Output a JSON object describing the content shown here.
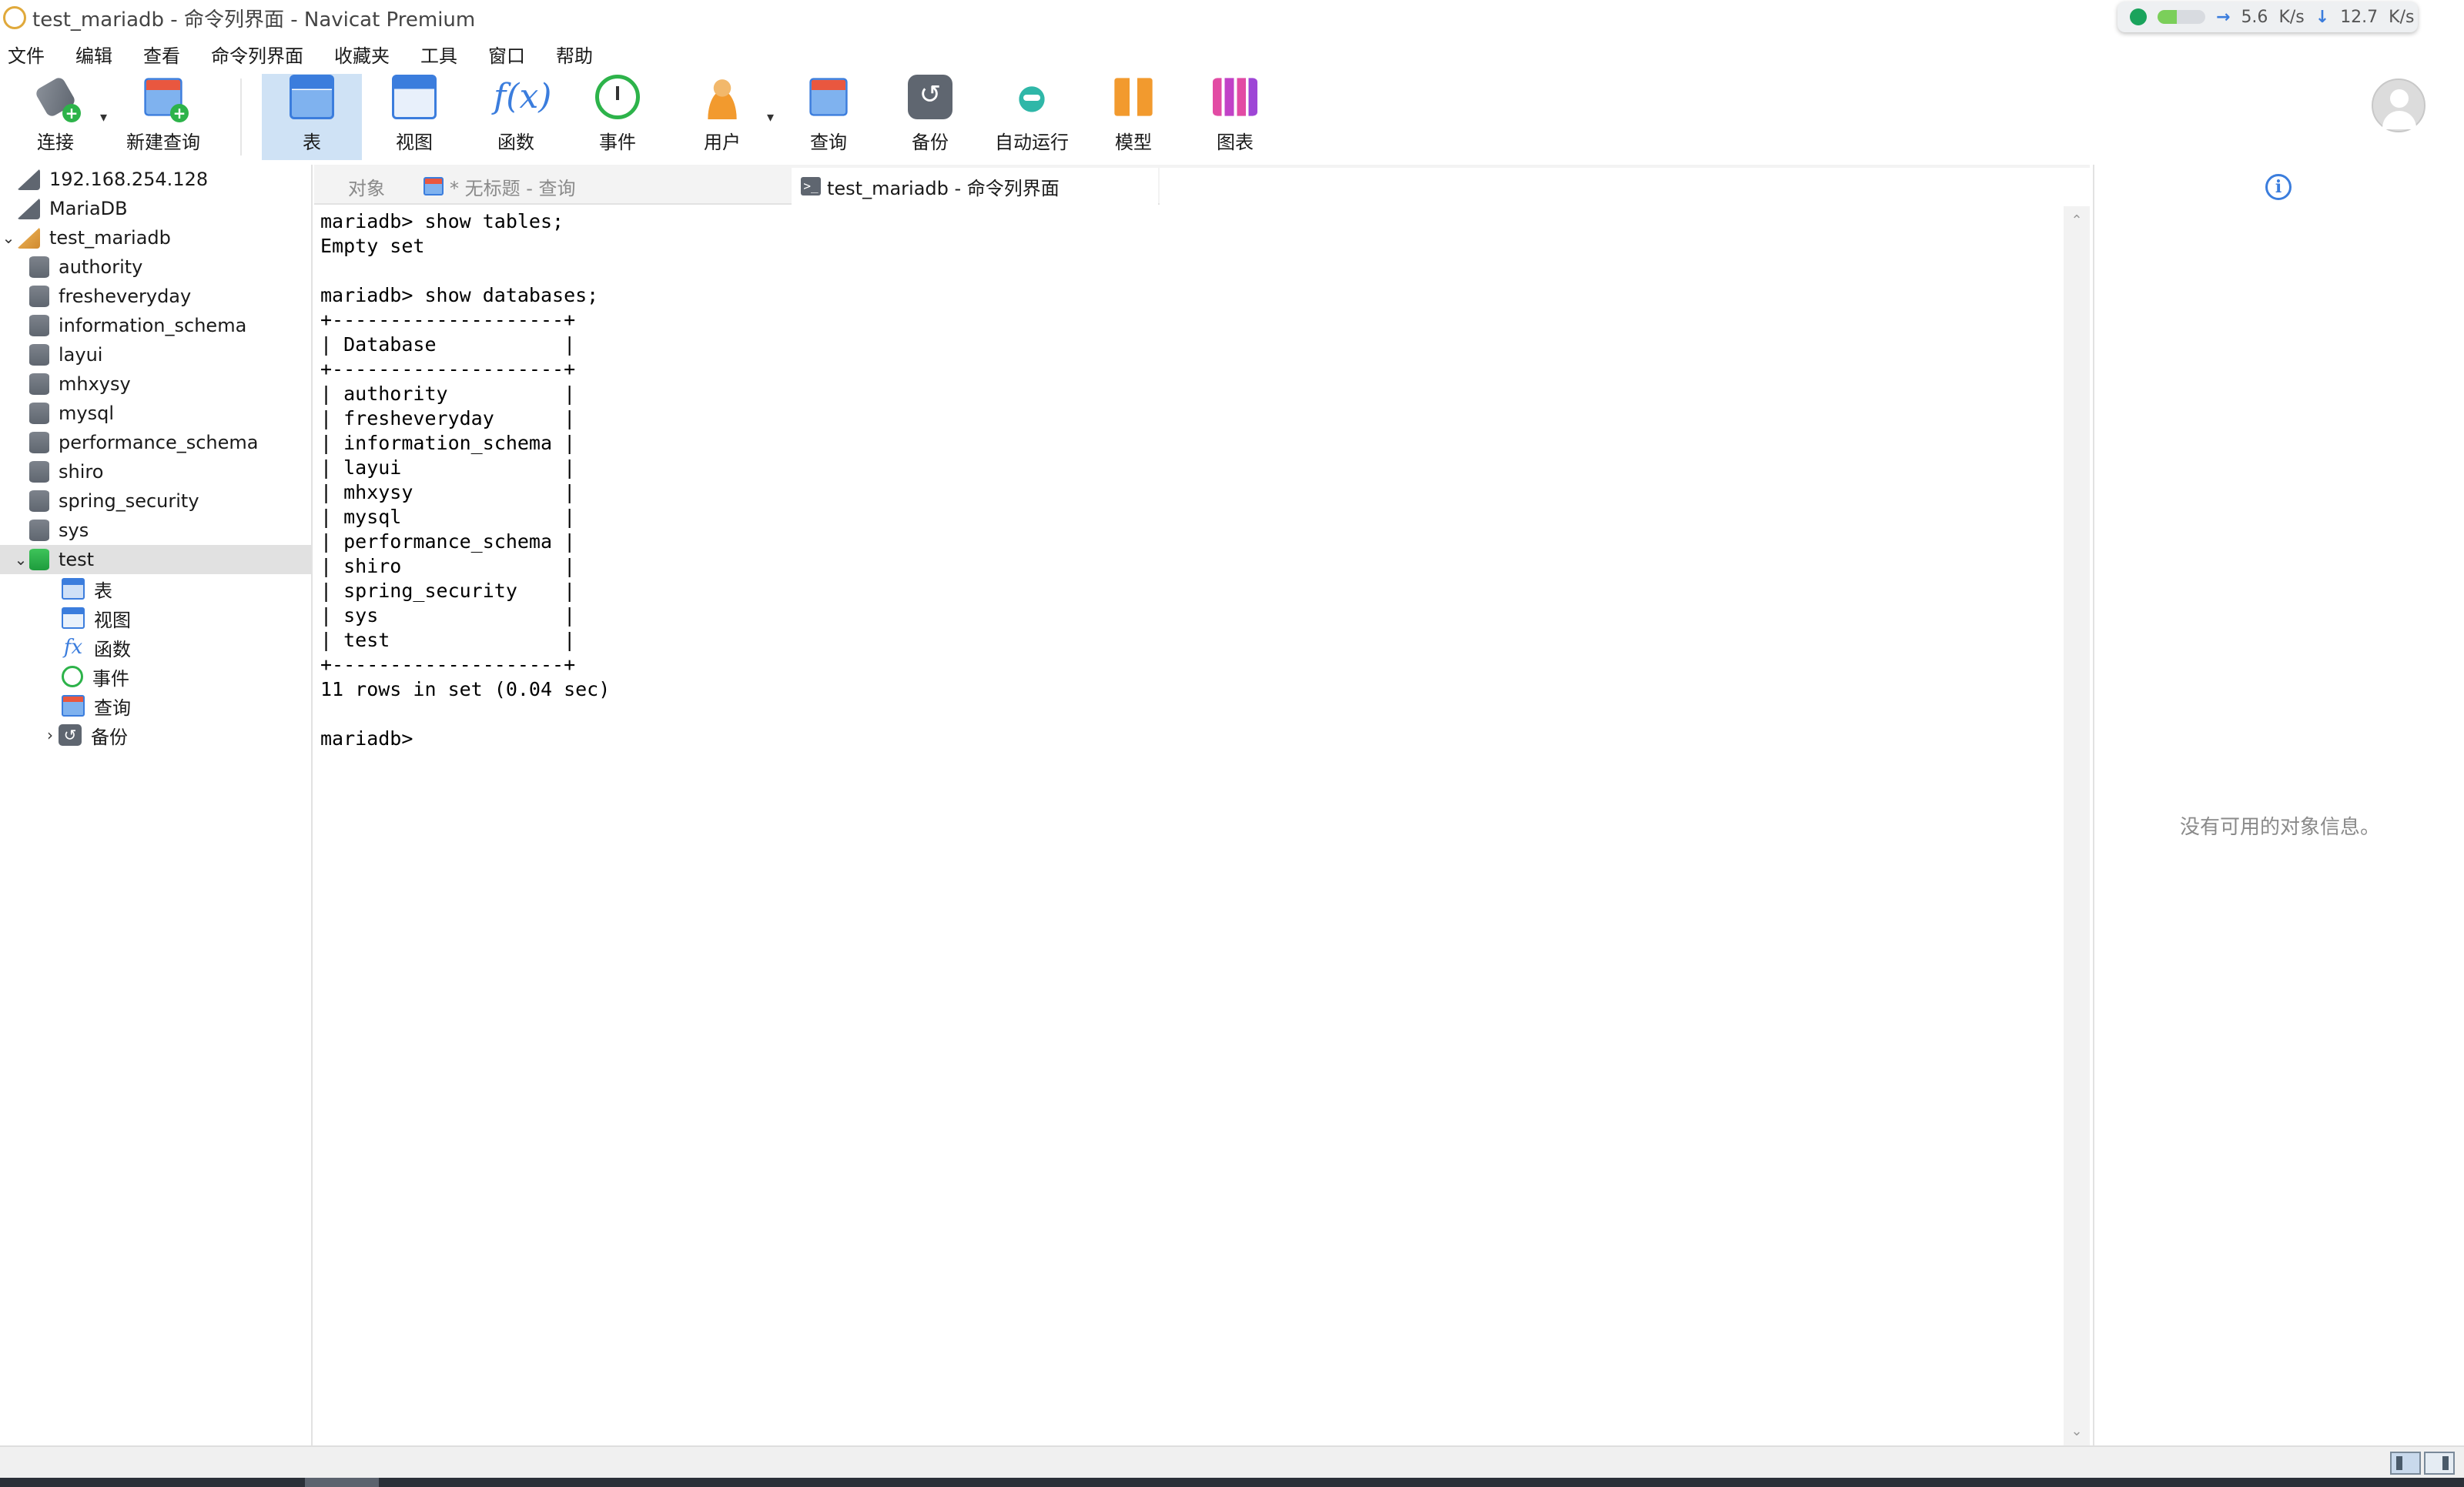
{
  "window": {
    "title": "test_mariadb - 命令列界面 - Navicat Premium"
  },
  "net_widget": {
    "upload": "5.6",
    "unit": "K/s",
    "download": "12.7",
    "download_unit": "K/s"
  },
  "menu": [
    "文件",
    "编辑",
    "查看",
    "命令列界面",
    "收藏夹",
    "工具",
    "窗口",
    "帮助"
  ],
  "toolbar": {
    "connect": "连接",
    "new_query": "新建查询",
    "table": "表",
    "view": "视图",
    "function": "函数",
    "event": "事件",
    "user": "用户",
    "query": "查询",
    "backup": "备份",
    "automation": "自动运行",
    "model": "模型",
    "chart": "图表"
  },
  "tree": {
    "connections": [
      "192.168.254.128",
      "MariaDB",
      "test_mariadb"
    ],
    "databases": [
      "authority",
      "fresheveryday",
      "information_schema",
      "layui",
      "mhxysy",
      "mysql",
      "performance_schema",
      "shiro",
      "spring_security",
      "sys",
      "test"
    ],
    "test_children": [
      "表",
      "视图",
      "函数",
      "事件",
      "查询",
      "备份"
    ]
  },
  "tabs": {
    "objects": "对象",
    "untitled_query": "* 无标题 - 查询",
    "console": "test_mariadb - 命令列界面"
  },
  "console": {
    "output": "mariadb> show tables;\nEmpty set\n\nmariadb> show databases;\n+--------------------+\n| Database           |\n+--------------------+\n| authority          |\n| fresheveryday      |\n| information_schema |\n| layui              |\n| mhxysy             |\n| mysql              |\n| performance_schema |\n| shiro              |\n| spring_security    |\n| sys                |\n| test               |\n+--------------------+\n11 rows in set (0.04 sec)\n\nmariadb> "
  },
  "info_panel": {
    "empty_message": "没有可用的对象信息。"
  },
  "colors": {
    "accent": "#3b7ddd",
    "selected_tool": "#cfe2f5",
    "selected_row": "#e1e1e1"
  }
}
